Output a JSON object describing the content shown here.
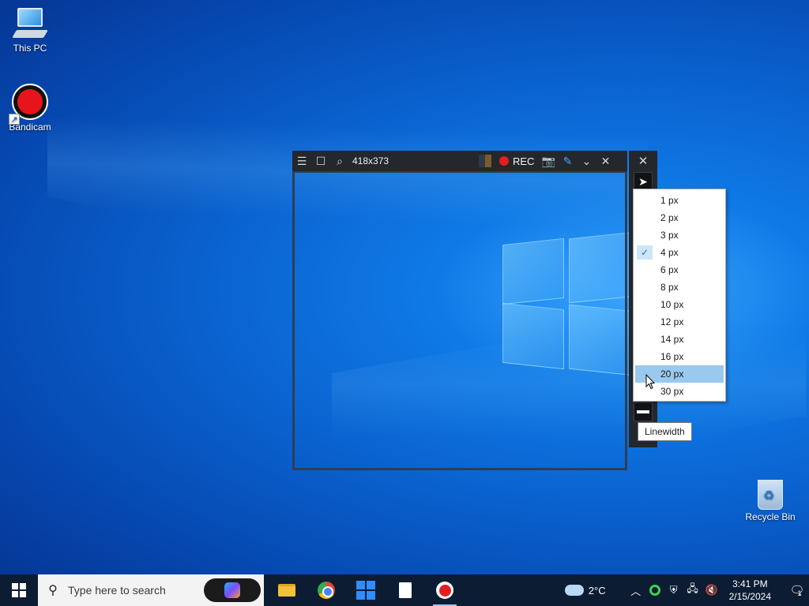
{
  "desktop": {
    "icons": [
      {
        "label": "This PC"
      },
      {
        "label": "Bandicam"
      },
      {
        "label": "Recycle Bin"
      }
    ]
  },
  "capture": {
    "size_label": "418x373",
    "rec_label": "REC"
  },
  "linewidth_menu": {
    "items": [
      "1 px",
      "2 px",
      "3 px",
      "4 px",
      "6 px",
      "8 px",
      "10 px",
      "12 px",
      "14 px",
      "16 px",
      "20 px",
      "30 px"
    ],
    "checked": "4 px",
    "hovered": "20 px",
    "checkmark": "✓"
  },
  "tooltip": {
    "text": "Linewidth"
  },
  "taskbar": {
    "search_placeholder": "Type here to search",
    "weather_temp": "2°C",
    "time": "3:41 PM",
    "date": "2/15/2024",
    "notification_count": "1"
  },
  "colors": {
    "accent": "#99c9ef",
    "rec": "#e41e1e",
    "toolbar_bg": "#24272c",
    "taskbar_bg": "#0c1c33"
  }
}
